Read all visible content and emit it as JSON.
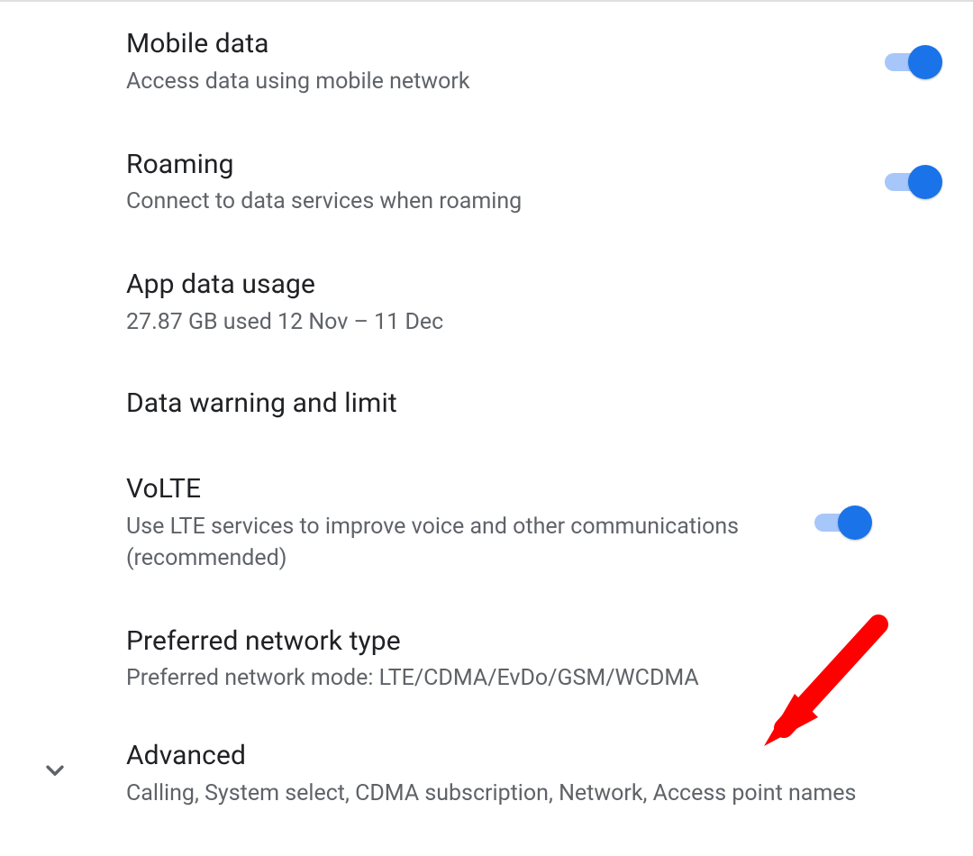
{
  "items": [
    {
      "key": "mobile-data",
      "title": "Mobile data",
      "subtitle": "Access data using mobile network",
      "toggle": true
    },
    {
      "key": "roaming",
      "title": "Roaming",
      "subtitle": "Connect to data services when roaming",
      "toggle": true
    },
    {
      "key": "app-data-usage",
      "title": "App data usage",
      "subtitle": "27.87 GB used 12 Nov – 11 Dec",
      "toggle": null
    },
    {
      "key": "data-warning-and-limit",
      "title": "Data warning and limit",
      "subtitle": null,
      "toggle": null
    },
    {
      "key": "volte",
      "title": "VoLTE",
      "subtitle": "Use LTE services to improve voice and other communications (recommended)",
      "toggle": true
    },
    {
      "key": "preferred-network-type",
      "title": "Preferred network type",
      "subtitle": "Preferred network mode: LTE/CDMA/EvDo/GSM/WCDMA",
      "toggle": null
    },
    {
      "key": "advanced",
      "title": "Advanced",
      "subtitle": "Calling, System select, CDMA subscription, Network, Access point names",
      "toggle": null,
      "expand": true
    }
  ]
}
